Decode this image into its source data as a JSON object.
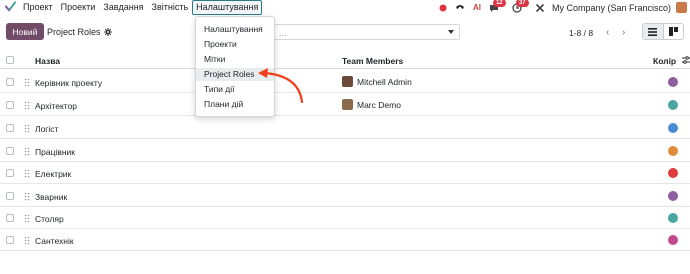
{
  "topbar": {
    "menu": [
      "Проект",
      "Проекти",
      "Завдання",
      "Звітність",
      "Налаштування"
    ],
    "badge_chat": "12",
    "badge_activity": "37",
    "company": "My Company (San Francisco)"
  },
  "control": {
    "new_button": "Новий",
    "breadcrumb": "Project Roles",
    "search_placeholder": "...",
    "pager": "1-8 / 8"
  },
  "dropdown": {
    "items": [
      "Налаштування",
      "Проекти",
      "Мітки",
      "Project Roles",
      "Типи дії",
      "Плани дій"
    ]
  },
  "table": {
    "headers": {
      "name": "Назва",
      "members": "Team Members",
      "color": "Колір"
    },
    "rows": [
      {
        "name": "Керівник проекту",
        "member": "Mitchell Admin",
        "color": "#8e5fa0"
      },
      {
        "name": "Архітектор",
        "member": "Marc Demo",
        "color": "#4aa7a0"
      },
      {
        "name": "Логіст",
        "member": "",
        "color": "#4a8ad6"
      },
      {
        "name": "Працівник",
        "member": "",
        "color": "#e08a3c"
      },
      {
        "name": "Електрик",
        "member": "",
        "color": "#e03c3c"
      },
      {
        "name": "Зварник",
        "member": "",
        "color": "#8e5fa0"
      },
      {
        "name": "Столяр",
        "member": "",
        "color": "#4aa7a0"
      },
      {
        "name": "Сантехнік",
        "member": "",
        "color": "#c04a8a"
      }
    ]
  }
}
